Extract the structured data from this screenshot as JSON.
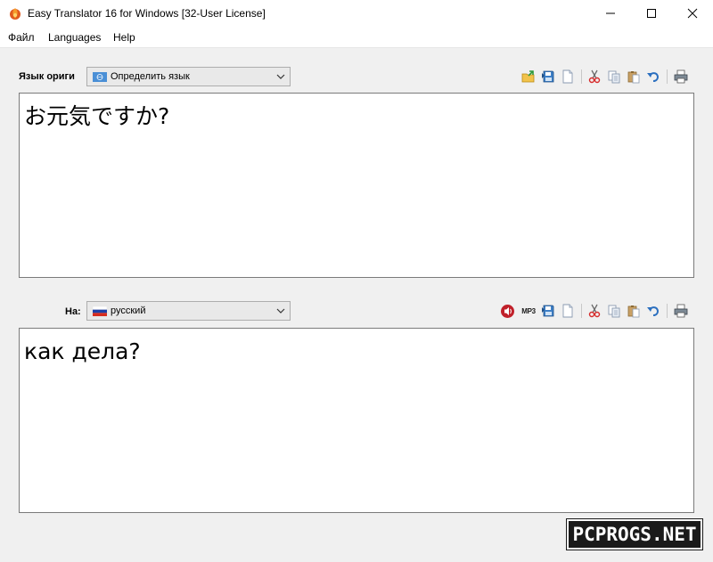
{
  "window": {
    "title": "Easy Translator 16 for Windows [32-User License]",
    "controls": {
      "minimize_icon": "minimize-icon",
      "maximize_icon": "maximize-icon",
      "close_icon": "close-icon"
    }
  },
  "menu": {
    "items": [
      "Файл",
      "Languages",
      "Help"
    ]
  },
  "source": {
    "label": "Язык ориги",
    "language": "Определить язык",
    "text": "お元気ですか?",
    "toolbar": [
      "open-icon",
      "save-icon",
      "new-icon",
      "cut-icon",
      "copy-icon",
      "paste-icon",
      "undo-icon",
      "print-icon"
    ]
  },
  "target": {
    "label": "На:",
    "language": "русский",
    "text": "как дела?",
    "mp3_label": "MP3",
    "toolbar": [
      "speak-icon",
      "mp3-icon",
      "save-icon",
      "new-icon",
      "cut-icon",
      "copy-icon",
      "paste-icon",
      "undo-icon",
      "print-icon"
    ]
  },
  "watermark": {
    "text": "PCPROGS.NET"
  },
  "colors": {
    "flag_ru_white": "#ffffff",
    "flag_ru_blue": "#1c3fa6",
    "flag_ru_red": "#d52b1e",
    "accent_blue": "#2b6fbf"
  }
}
